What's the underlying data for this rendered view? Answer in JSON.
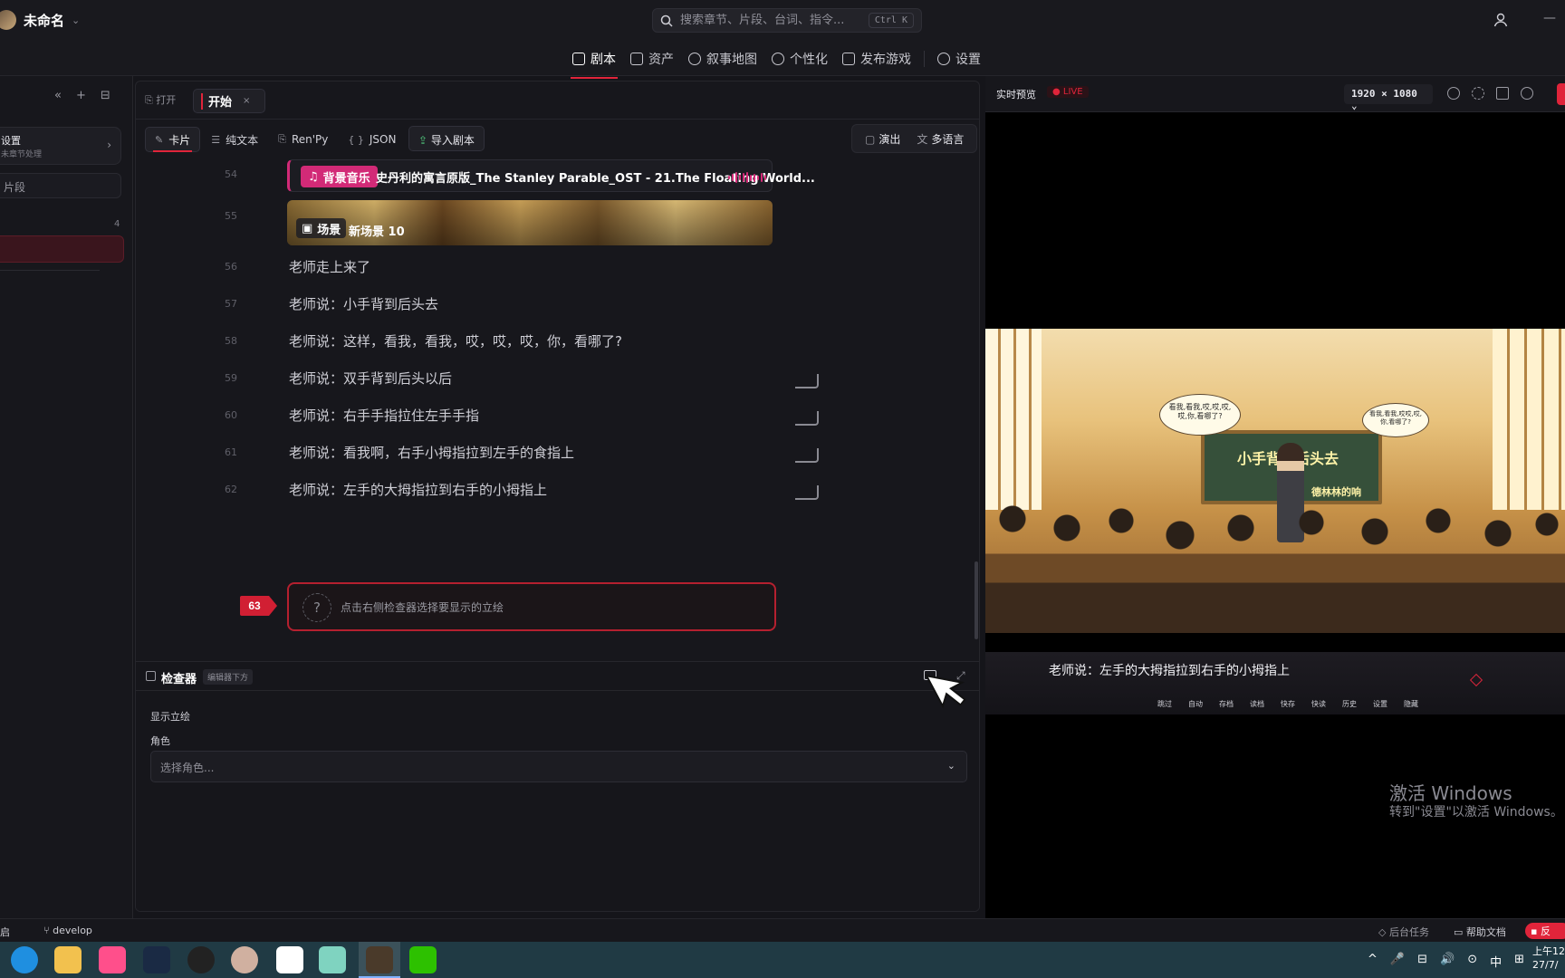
{
  "titlebar": {
    "project_name": "未命名",
    "search_placeholder": "搜索章节、片段、台词、指令...",
    "search_shortcut": "Ctrl K"
  },
  "nav": [
    {
      "label": "剧本",
      "icon": "book-icon",
      "active": true
    },
    {
      "label": "资产",
      "icon": "assets-icon"
    },
    {
      "label": "叙事地图",
      "icon": "branch-icon"
    },
    {
      "label": "个性化",
      "icon": "palette-icon"
    },
    {
      "label": "发布游戏",
      "icon": "cube-icon"
    },
    {
      "label": "设置",
      "icon": "gear-icon"
    }
  ],
  "sidebar": {
    "tools": [
      "«",
      "+",
      "⊟"
    ],
    "card_title": "设置",
    "card_sub": "未章节处理",
    "segment_placeholder": "片段",
    "count": "4"
  },
  "editor": {
    "tab_open": "打开",
    "tab_start": "开始",
    "modes": [
      {
        "label": "卡片",
        "glyph": "✎"
      },
      {
        "label": "纯文本",
        "glyph": "☰"
      },
      {
        "label": "Ren'Py",
        "glyph": "⎘"
      },
      {
        "label": "JSON",
        "glyph": "{ }"
      }
    ],
    "import_label": "导入剧本",
    "perform_label": "演出",
    "language_label": "多语言",
    "bgm": {
      "num": "54",
      "badge": "背景音乐",
      "title": "史丹利的寓言原版_The Stanley Parable_OST - 21.The Floating World..."
    },
    "scene": {
      "num": "55",
      "badge": "场景",
      "name": "新场景 10"
    },
    "lines": [
      {
        "num": "56",
        "text": "老师走上来了",
        "bracket": false
      },
      {
        "num": "57",
        "text": "老师说：小手背到后头去",
        "bracket": false
      },
      {
        "num": "58",
        "text": "老师说：这样，看我，看我，哎，哎，哎，你，看哪了?",
        "bracket": false
      },
      {
        "num": "59",
        "text": "老师说：双手背到后头以后",
        "bracket": true
      },
      {
        "num": "60",
        "text": "老师说：右手手指拉住左手手指",
        "bracket": true
      },
      {
        "num": "61",
        "text": "老师说：看我啊，右手小拇指拉到左手的食指上",
        "bracket": true
      },
      {
        "num": "62",
        "text": "老师说：左手的大拇指拉到右手的小拇指上",
        "bracket": true
      }
    ],
    "new_line": {
      "num": "63",
      "icon_text": "?",
      "hint": "点击右侧检查器选择要显示的立绘"
    }
  },
  "inspector": {
    "title": "检查器",
    "badge": "编辑器下方",
    "section": "显示立绘",
    "role_label": "角色",
    "role_placeholder": "选择角色..."
  },
  "preview": {
    "title": "实时预览",
    "live": "LIVE",
    "resolution": "1920 × 1080",
    "board_text": "小手背到后头去",
    "board_sub": "德林林的响",
    "bubble_left": "看我,看我,哎,哎,哎,哎,你,看哪了?",
    "bubble_right": "看我,看我,哎哎,哎,你,看哪了?",
    "dialog": "老师说：左手的大拇指拉到右手的小拇指上",
    "menu": [
      "跳过",
      "自动",
      "存档",
      "读档",
      "快存",
      "快读",
      "历史",
      "设置",
      "隐藏"
    ],
    "activate_title": "激活 Windows",
    "activate_sub": "转到\"设置\"以激活 Windows。"
  },
  "status": {
    "start": "启",
    "branch": "develop",
    "tasks": "后台任务",
    "docs": "帮助文档",
    "feedback": "反"
  },
  "taskbar": {
    "apps": [
      "edge-icon",
      "files-icon",
      "music-icon",
      "steam-icon",
      "obs-icon",
      "avatar-app-icon",
      "capcut-icon",
      "notes-icon",
      "game-icon",
      "wechat-icon"
    ],
    "colors": [
      "#1f8fe0",
      "#f2c14e",
      "#ff4f8b",
      "#1a2a44",
      "#222222",
      "#d0b0a0",
      "#ffffff",
      "#7fd3c0",
      "#4a3a2a",
      "#2dc100"
    ],
    "tray": [
      "^",
      "🎤",
      "⊟",
      "🔊",
      "⊙",
      "中",
      "⊞"
    ],
    "time": "上午12",
    "date": "27/7/"
  },
  "colors": {
    "accent": "#e0243a",
    "bgm": "#d22a77",
    "background": "#15151a"
  }
}
